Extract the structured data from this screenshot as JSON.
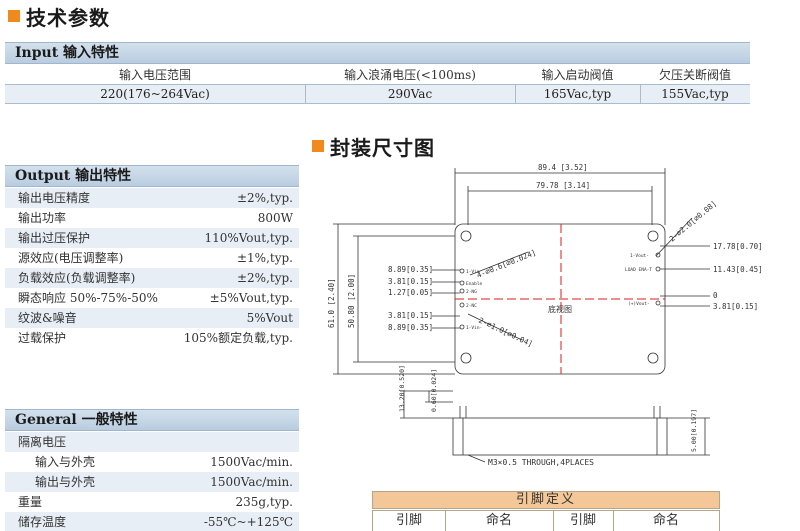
{
  "section_tech": {
    "title": "技术参数"
  },
  "section_input": {
    "title": "Input 输入特性",
    "headers": [
      "输入电压范围",
      "输入浪涌电压(<100ms)",
      "输入启动阀值",
      "欠压关断阀值"
    ],
    "values": [
      "220(176~264Vac)",
      "290Vac",
      "165Vac,typ",
      "155Vac,typ"
    ]
  },
  "section_package": {
    "title": "封装尺寸图"
  },
  "section_output": {
    "title": "Output 输出特性",
    "rows": [
      {
        "label": "输出电压精度",
        "value": "±2%,typ."
      },
      {
        "label": "输出功率",
        "value": "800W"
      },
      {
        "label": "输出过压保护",
        "value": "110%Vout,typ."
      },
      {
        "label": "源效应(电压调整率)",
        "value": "±1%,typ."
      },
      {
        "label": "负载效应(负载调整率)",
        "value": "±2%,typ."
      },
      {
        "label": "瞬态响应 50%-75%-50%",
        "value": "±5%Vout,typ."
      },
      {
        "label": "纹波&噪音",
        "value": "5%Vout"
      },
      {
        "label": "过载保护",
        "value": "105%额定负载,typ."
      }
    ]
  },
  "section_general": {
    "title": "General 一般特性",
    "rows": [
      {
        "label": "隔离电压",
        "value": ""
      },
      {
        "label": "输入与外壳",
        "value": "1500Vac/min."
      },
      {
        "label": "输出与外壳",
        "value": "1500Vac/min."
      },
      {
        "label": "重量",
        "value": "235g,typ."
      },
      {
        "label": "储存温度",
        "value": "-55℃~+125℃"
      }
    ]
  },
  "drawing": {
    "dim_total_width": "89.4 [3.52]",
    "dim_hole_width": "79.78 [3.14]",
    "dim_total_height": "61.0 [2.40]",
    "dim_hole_height": "50.80 [2.00]",
    "dim_r1": "8.89[0.35]",
    "dim_r2": "3.81[0.15]",
    "dim_r3": "1.27[0.05]",
    "dim_r4": "3.81[0.15]",
    "dim_r5": "8.89[0.35]",
    "dim_right1": "17.78[0.70]",
    "dim_right2": "11.43[0.45]",
    "dim_right3": "0",
    "dim_right4": "3.81[0.15]",
    "callout_top_right": "2-⌀2.0[⌀0.08]",
    "callout_left_pins": "4-⌀0.6[⌀0.024]",
    "callout_bottom_left": "2-⌀1.0[⌀0.04]",
    "pin_label_vin_pos": "1-Vin",
    "pin_label_enable": "Enable",
    "pin_label_ng": "2-NG",
    "pin_label_nc": "2-NC",
    "pin_label_vin_neg": "1-Vin-",
    "pin_label_vout_neg": "1-Vout-",
    "pin_label_load": "LOAD ENA-T",
    "pin_label_vout_pos": "(+)Vout-",
    "bottom_view": "底视图",
    "side_h1": "13.20[0.520]",
    "side_h2": "0.60[0.024]",
    "side_h3": "5.00[0.197]",
    "thread_note": "M3×0.5 THROUGH,4PLACES"
  },
  "pin_table": {
    "title": "引脚定义",
    "headers": [
      "引脚",
      "命名",
      "引脚",
      "命名"
    ]
  }
}
